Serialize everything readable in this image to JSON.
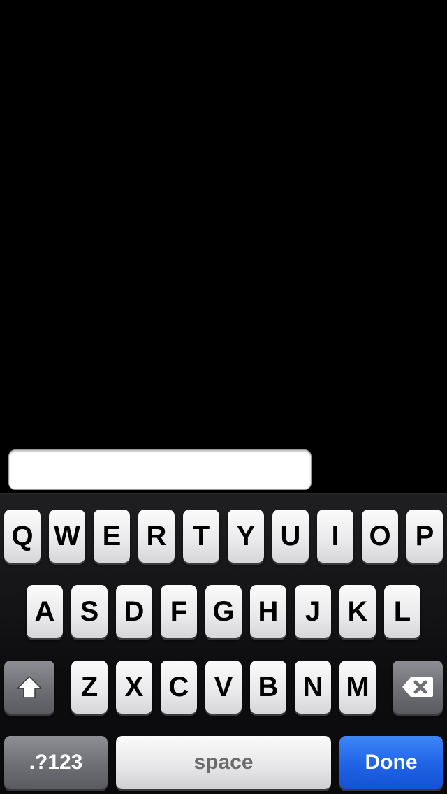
{
  "text_field": {
    "value": "",
    "placeholder": ""
  },
  "keyboard": {
    "row1": [
      "Q",
      "W",
      "E",
      "R",
      "T",
      "Y",
      "U",
      "I",
      "O",
      "P"
    ],
    "row2": [
      "A",
      "S",
      "D",
      "F",
      "G",
      "H",
      "J",
      "K",
      "L"
    ],
    "row3": [
      "Z",
      "X",
      "C",
      "V",
      "B",
      "N",
      "M"
    ],
    "shift_icon": "shift-arrow-icon",
    "delete_icon": "backspace-icon",
    "numbers_label": ".?123",
    "space_label": "space",
    "return_label": "Done"
  },
  "colors": {
    "background": "#000000",
    "key_face": "#ececee",
    "modifier_key": "#6e6f74",
    "done_key": "#1f63e6"
  }
}
